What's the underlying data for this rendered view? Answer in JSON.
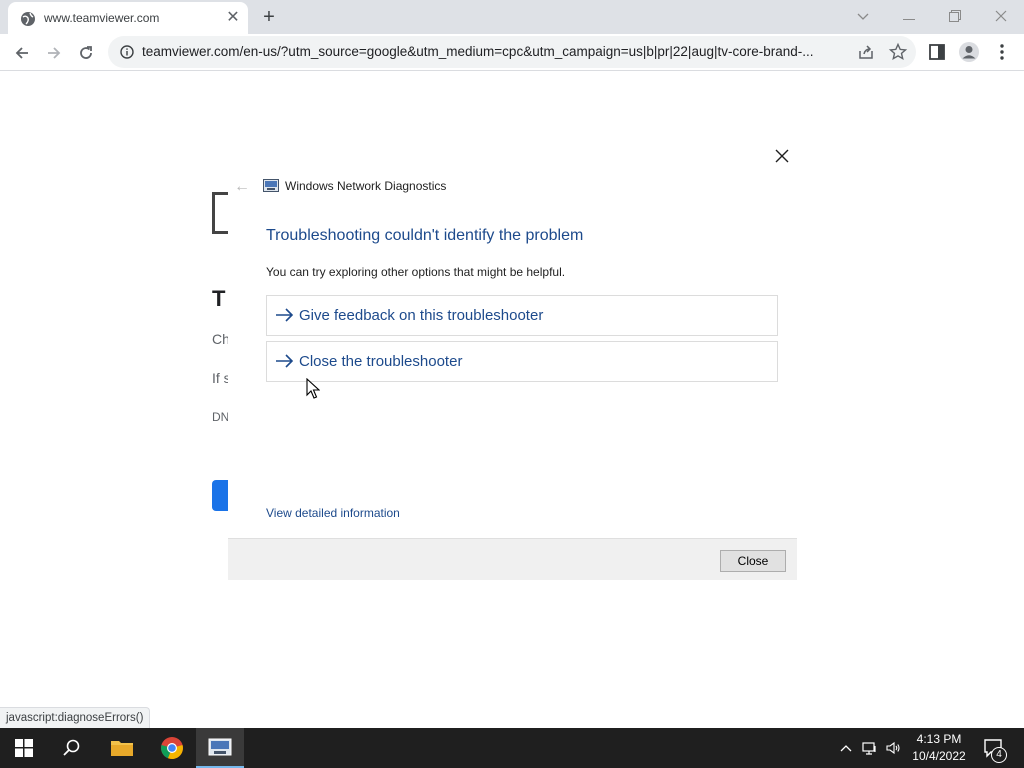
{
  "browser": {
    "tab": {
      "title": "www.teamviewer.com"
    },
    "address_bar": {
      "url": "teamviewer.com/en-us/?utm_source=google&utm_medium=cpc&utm_campaign=us|b|pr|22|aug|tv-core-brand-..."
    },
    "status_bubble": "javascript:diagnoseErrors()"
  },
  "background_page": {
    "title_fragment": "T",
    "line1_fragment": "Ch",
    "line2_fragment": "If s",
    "line3_fragment": "DN"
  },
  "dialog": {
    "app_title": "Windows Network Diagnostics",
    "heading": "Troubleshooting couldn't identify the problem",
    "subtext": "You can try exploring other options that might be helpful.",
    "options": [
      {
        "label": "Give feedback on this troubleshooter"
      },
      {
        "label": "Close the troubleshooter"
      }
    ],
    "details_link": "View detailed information",
    "close_button": "Close"
  },
  "taskbar": {
    "time": "4:13 PM",
    "date": "10/4/2022",
    "notification_count": "4"
  },
  "colors": {
    "dialog_link": "#1d4a8c",
    "taskbar_bg": "#1f1f1f",
    "tab_strip": "#dee1e6"
  }
}
